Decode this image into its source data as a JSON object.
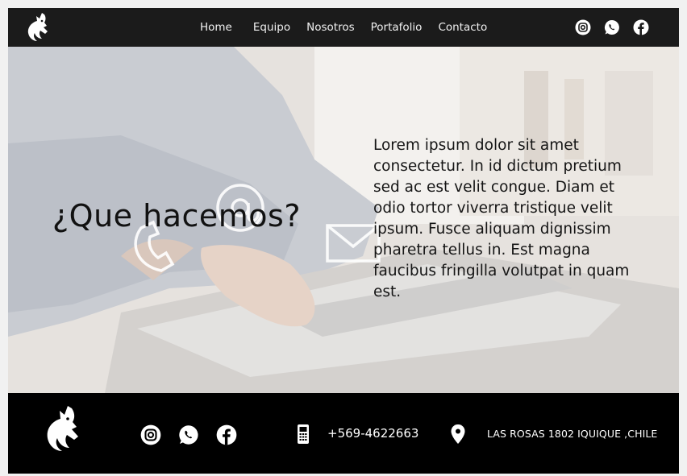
{
  "nav": {
    "logo_icon": "dragon-logo-icon",
    "items": [
      {
        "label": "Home"
      },
      {
        "label": "Equipo"
      },
      {
        "label": "Nosotros"
      },
      {
        "label": "Portafolio"
      },
      {
        "label": "Contacto"
      }
    ],
    "social": [
      "instagram-icon",
      "whatsapp-icon",
      "facebook-icon"
    ]
  },
  "hero": {
    "title": "¿Que hacemos?",
    "text": "Lorem ipsum dolor sit amet consectetur. In id dictum pretium sed ac est velit congue. Diam et odio tortor viverra tristique velit ipsum. Fusce aliquam dignissim pharetra tellus in. Est magna faucibus fringilla volutpat in quam est."
  },
  "footer": {
    "logo_icon": "dragon-logo-icon",
    "social": [
      "instagram-icon",
      "whatsapp-icon",
      "facebook-icon"
    ],
    "phone": "+569-4622663",
    "address": "LAS ROSAS 1802 IQUIQUE ,CHILE"
  },
  "colors": {
    "nav_bg": "#1b1b1b",
    "footer_bg": "#000000",
    "text_light": "#ffffff",
    "hero_text": "#111111"
  }
}
